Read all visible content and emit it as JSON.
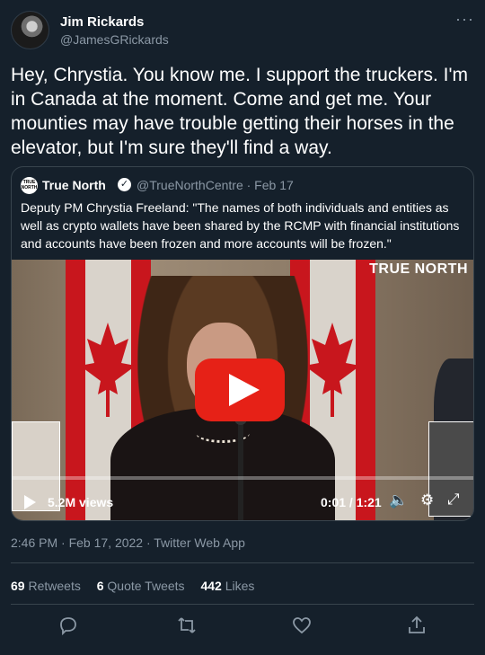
{
  "author": {
    "name": "Jim Rickards",
    "handle": "@JamesGRickards"
  },
  "more_label": "···",
  "tweet_text": "Hey, Chrystia. You know me. I support the truckers. I'm in Canada at the moment. Come and get me. Your mounties may have trouble getting their horses in the elevator, but I'm sure they'll find a way.",
  "quoted": {
    "avatar_text": "TRUE NORTH",
    "name": "True North",
    "handle_date": "@TrueNorthCentre · Feb 17",
    "text": "Deputy PM Chrystia Freeland: \"The names of both individuals and entities as well as crypto wallets have been shared by the RCMP with financial institutions and accounts have been frozen and more accounts will be frozen.\"",
    "video": {
      "brand": "TRUE NORTH",
      "views": "5.2M views",
      "time": "0:01 / 1:21",
      "play_color": "#e62117"
    }
  },
  "meta": "2:46 PM · Feb 17, 2022 · Twitter Web App",
  "stats": {
    "retweets_count": "69",
    "retweets_label": "Retweets",
    "quotes_count": "6",
    "quotes_label": "Quote Tweets",
    "likes_count": "442",
    "likes_label": "Likes"
  },
  "actions": [
    "reply-icon",
    "retweet-icon",
    "like-icon",
    "share-icon"
  ],
  "colors": {
    "background": "#15202b",
    "secondary_text": "#8b98a5",
    "border": "#38444d"
  }
}
